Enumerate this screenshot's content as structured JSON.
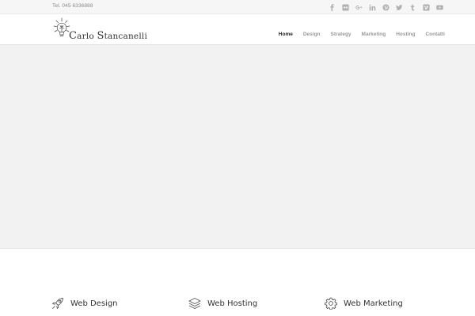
{
  "topbar": {
    "phone": "Tel. 045 6336888",
    "social": [
      {
        "icon": "facebook-icon"
      },
      {
        "icon": "flickr-icon"
      },
      {
        "icon": "google-plus-icon"
      },
      {
        "icon": "linkedin-icon"
      },
      {
        "icon": "pinterest-icon"
      },
      {
        "icon": "twitter-icon"
      },
      {
        "icon": "tumblr-icon"
      },
      {
        "icon": "vimeo-icon"
      },
      {
        "icon": "youtube-icon"
      }
    ]
  },
  "header": {
    "logo_text_first_initial": "C",
    "logo_text_first_rest": "arlo ",
    "logo_text_last_initial": "S",
    "logo_text_last_rest": "tancanelli",
    "nav": [
      "Home",
      "Design",
      "Strategy",
      "Marketing",
      "Hosting",
      "Contatti"
    ],
    "active_nav": "Home"
  },
  "services": [
    {
      "title": "Web Design",
      "icon": "rocket-icon"
    },
    {
      "title": "Web Hosting",
      "icon": "layers-icon"
    },
    {
      "title": "Web Marketing",
      "icon": "gear-icon"
    }
  ],
  "colors": {
    "topbar_bg": "#f6f6f6",
    "hero_bg": "#f2f2f2",
    "nav_active": "#222222",
    "nav_inactive": "#9a9a9a",
    "social_icon": "#b0b0b0"
  }
}
